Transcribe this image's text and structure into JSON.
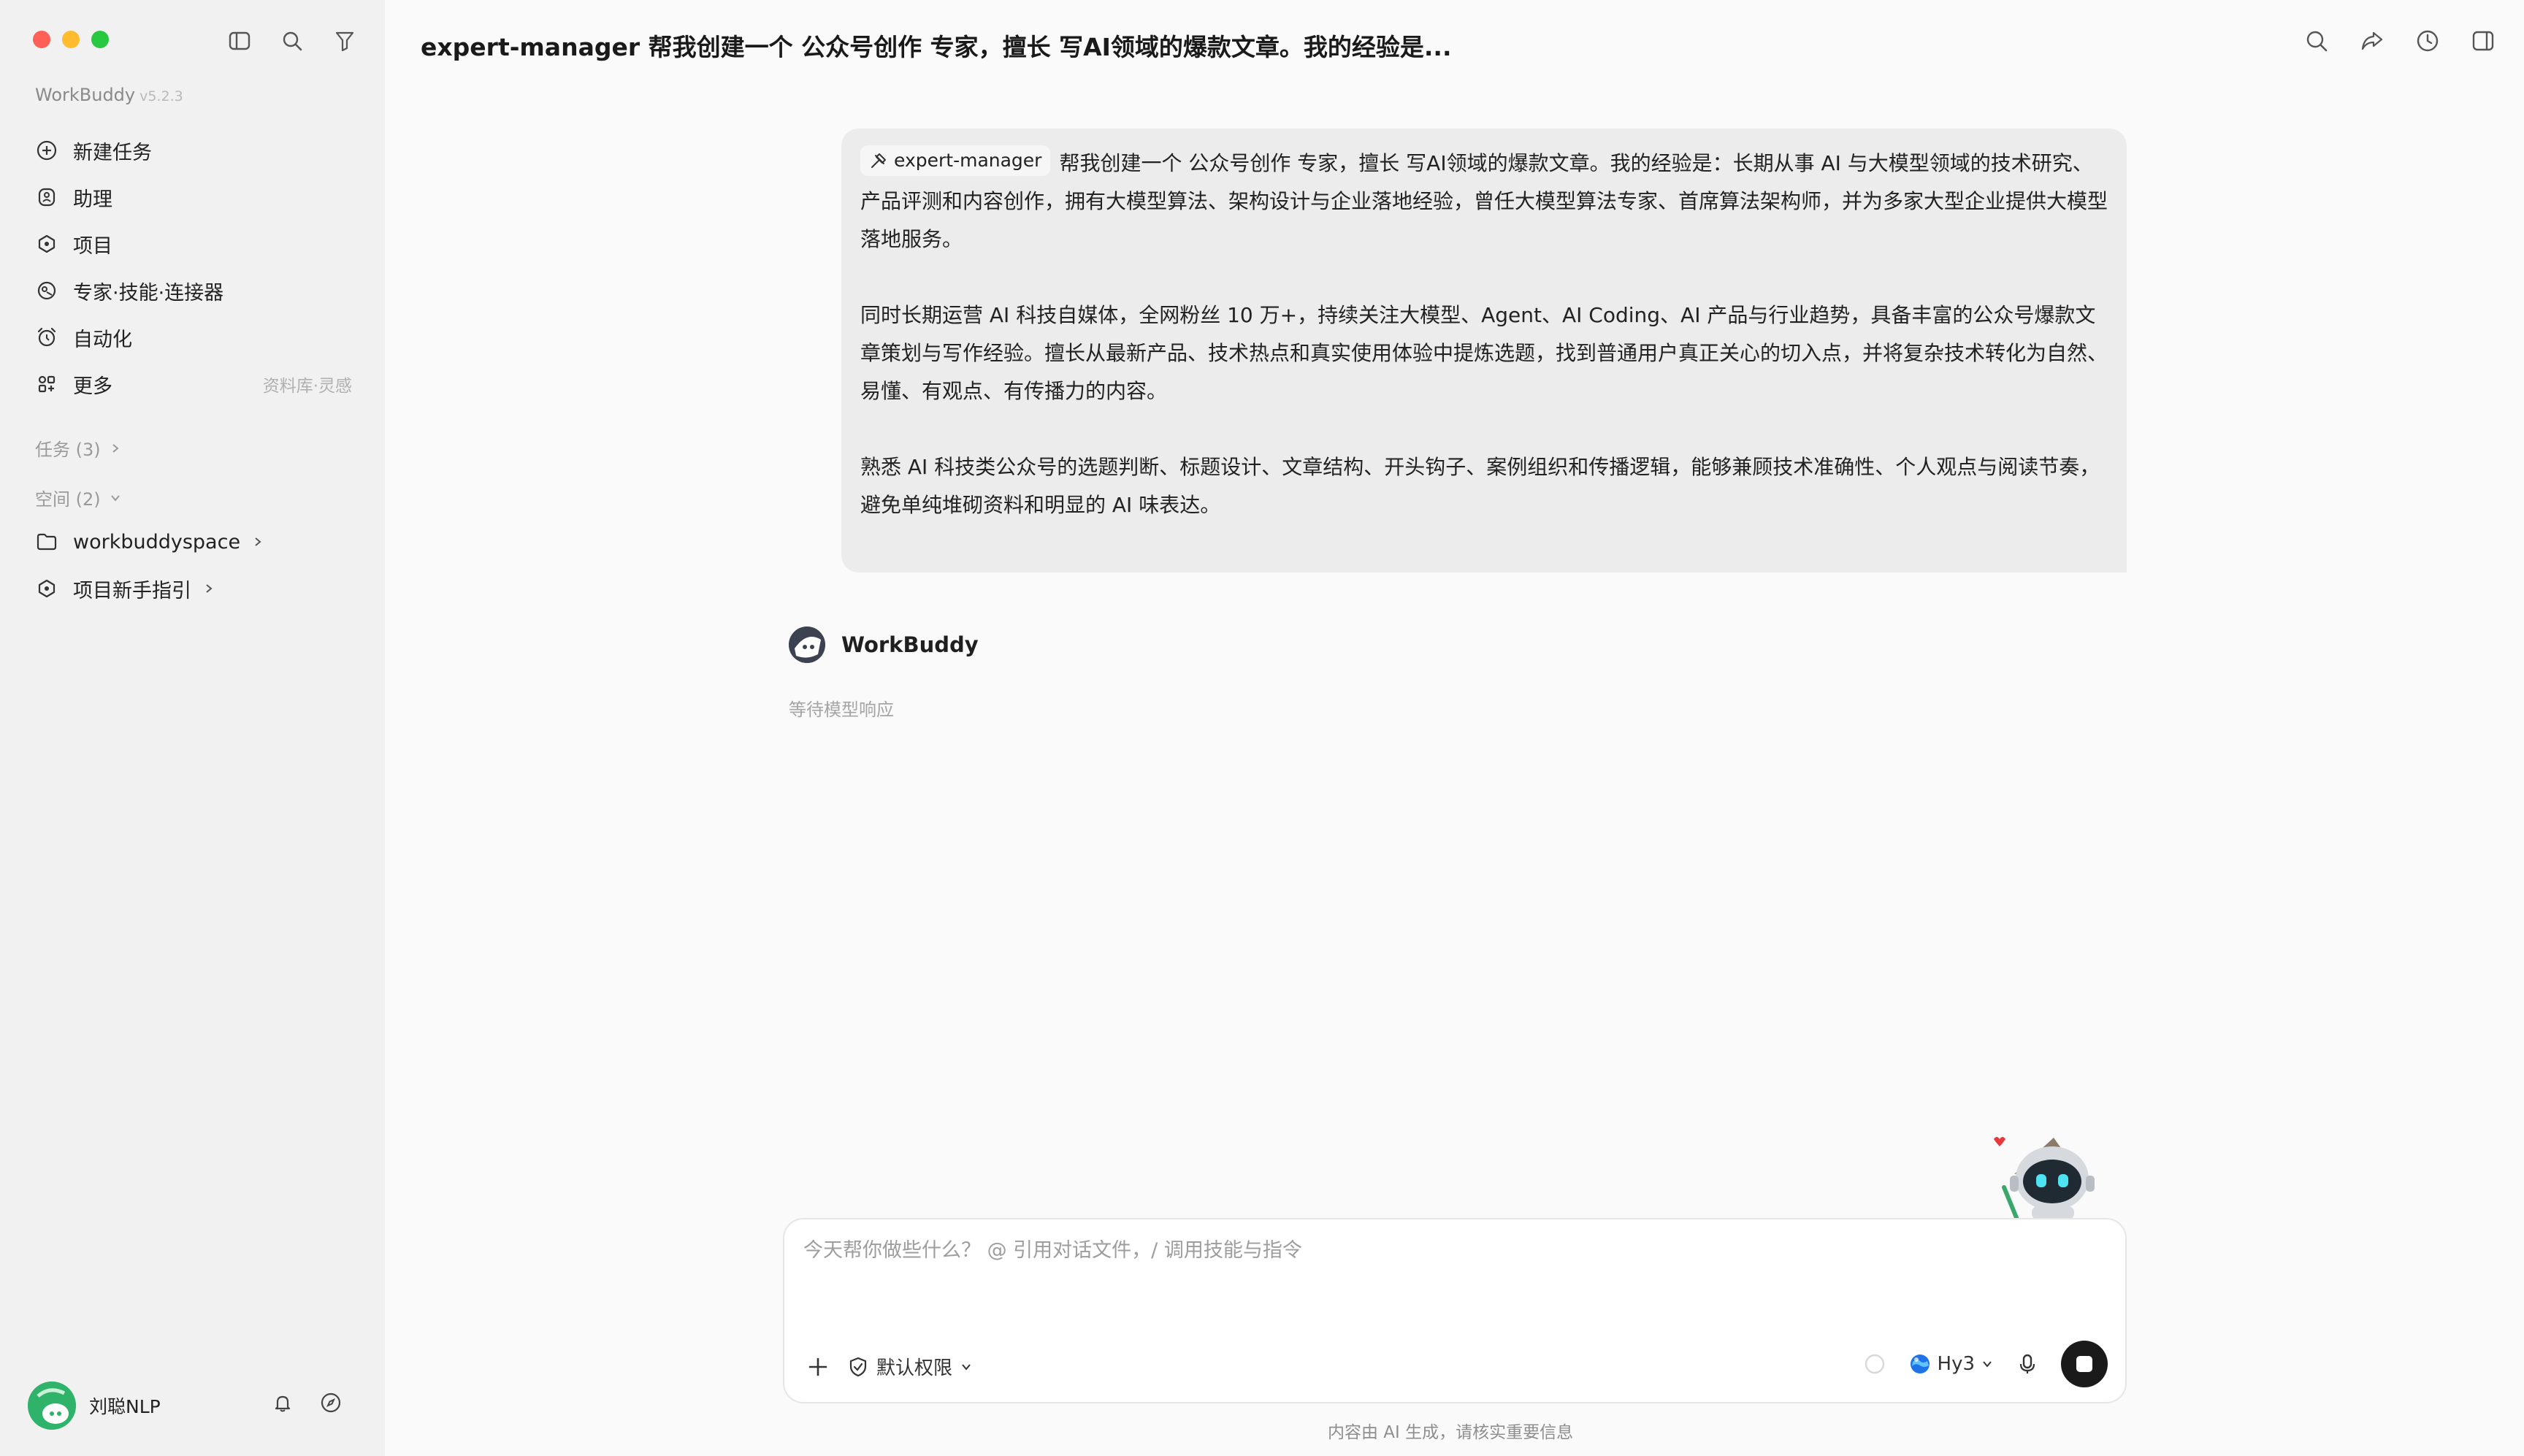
{
  "app": {
    "name": "WorkBuddy",
    "version": "v5.2.3"
  },
  "sidebar": {
    "nav": [
      {
        "label": "新建任务",
        "icon": "plus-circle-icon"
      },
      {
        "label": "助理",
        "icon": "assistant-icon"
      },
      {
        "label": "项目",
        "icon": "project-icon"
      },
      {
        "label": "专家·技能·连接器",
        "icon": "expert-icon"
      },
      {
        "label": "自动化",
        "icon": "alarm-clock-icon"
      },
      {
        "label": "更多",
        "icon": "apps-icon",
        "hint": "资料库·灵感"
      }
    ],
    "tasks_header": "任务 (3)",
    "spaces_header": "空间 (2)",
    "spaces": [
      {
        "label": "workbuddyspace",
        "icon": "folder-icon"
      },
      {
        "label": "项目新手指引",
        "icon": "project-icon"
      }
    ]
  },
  "user": {
    "name": "刘聪NLP"
  },
  "header": {
    "title": "expert-manager 帮我创建一个 公众号创作 专家，擅长 写AI领域的爆款文章。我的经验是..."
  },
  "message": {
    "chip": "expert-manager",
    "para1": "帮我创建一个 公众号创作 专家，擅长 写AI领域的爆款文章。我的经验是：长期从事 AI 与大模型领域的技术研究、产品评测和内容创作，拥有大模型算法、架构设计与企业落地经验，曾任大模型算法专家、首席算法架构师，并为多家大型企业提供大模型落地服务。",
    "para2": "同时长期运营 AI 科技自媒体，全网粉丝 10 万+，持续关注大模型、Agent、AI Coding、AI 产品与行业趋势，具备丰富的公众号爆款文章策划与写作经验。擅长从最新产品、技术热点和真实使用体验中提炼选题，找到普通用户真正关心的切入点，并将复杂技术转化为自然、易懂、有观点、有传播力的内容。",
    "para3": "熟悉 AI 科技类公众号的选题判断、标题设计、文章结构、开头钩子、案例组织和传播逻辑，能够兼顾技术准确性、个人观点与阅读节奏，避免单纯堆砌资料和明显的 AI 味表达。"
  },
  "reply": {
    "name": "WorkBuddy",
    "status": "等待模型响应"
  },
  "composer": {
    "placeholder": "今天帮你做些什么？ @ 引用对话文件，/ 调用技能与指令",
    "permission": "默认权限",
    "model": "Hy3"
  },
  "footer": {
    "note": "内容由 AI 生成，请核实重要信息"
  }
}
